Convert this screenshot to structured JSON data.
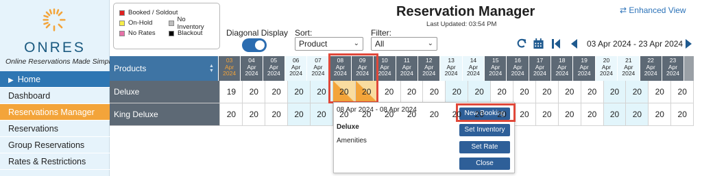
{
  "brand": {
    "name": "ONRES",
    "tagline": "Online Reservations Made Simple"
  },
  "sidebar": {
    "items": [
      {
        "label": "Home"
      },
      {
        "label": "Dashboard"
      },
      {
        "label": "Reservations Manager"
      },
      {
        "label": "Reservations"
      },
      {
        "label": "Group Reservations"
      },
      {
        "label": "Rates & Restrictions"
      }
    ]
  },
  "legend": {
    "booked": "Booked / Soldout",
    "onhold": "On-Hold",
    "noinventory": "No Inventory",
    "norates": "No Rates",
    "blackout": "Blackout",
    "colors": {
      "booked": "#e02020",
      "onhold": "#f7ee4a",
      "noinventory": "#bdbdbd",
      "norates": "#e772a8",
      "blackout": "#000000"
    }
  },
  "header": {
    "title": "Reservation Manager",
    "updated": "Last Updated: 03:54 PM",
    "enhanced": "Enhanced View"
  },
  "controls": {
    "diagonal_label": "Diagonal Display",
    "diagonal_on": true,
    "sort_label": "Sort:",
    "sort_value": "Product",
    "filter_label": "Filter:",
    "filter_value": "All",
    "date_range": "03 Apr 2024 - 23 Apr 2024"
  },
  "icons": [
    "refresh-icon",
    "calendar-icon",
    "first-page-icon",
    "prev-icon",
    "next-icon",
    "swap-icon",
    "sun-logo-icon"
  ],
  "grid": {
    "header_label": "Products",
    "dates": [
      {
        "d": "03",
        "m": "Apr",
        "y": "2024"
      },
      {
        "d": "04",
        "m": "Apr",
        "y": "2024"
      },
      {
        "d": "05",
        "m": "Apr",
        "y": "2024"
      },
      {
        "d": "06",
        "m": "Apr",
        "y": "2024"
      },
      {
        "d": "07",
        "m": "Apr",
        "y": "2024"
      },
      {
        "d": "08",
        "m": "Apr",
        "y": "2024"
      },
      {
        "d": "09",
        "m": "Apr",
        "y": "2024"
      },
      {
        "d": "10",
        "m": "Apr",
        "y": "2024"
      },
      {
        "d": "11",
        "m": "Apr",
        "y": "2024"
      },
      {
        "d": "12",
        "m": "Apr",
        "y": "2024"
      },
      {
        "d": "13",
        "m": "Apr",
        "y": "2024"
      },
      {
        "d": "14",
        "m": "Apr",
        "y": "2024"
      },
      {
        "d": "15",
        "m": "Apr",
        "y": "2024"
      },
      {
        "d": "16",
        "m": "Apr",
        "y": "2024"
      },
      {
        "d": "17",
        "m": "Apr",
        "y": "2024"
      },
      {
        "d": "18",
        "m": "Apr",
        "y": "2024"
      },
      {
        "d": "19",
        "m": "Apr",
        "y": "2024"
      },
      {
        "d": "20",
        "m": "Apr",
        "y": "2024"
      },
      {
        "d": "21",
        "m": "Apr",
        "y": "2024"
      },
      {
        "d": "22",
        "m": "Apr",
        "y": "2024"
      },
      {
        "d": "23",
        "m": "Apr",
        "y": "2024"
      }
    ],
    "rooms": [
      {
        "name": "Deluxe",
        "values": [
          "19",
          "20",
          "20",
          "20",
          "20",
          "20",
          "20",
          "20",
          "20",
          "20",
          "20",
          "20",
          "20",
          "20",
          "20",
          "20",
          "20",
          "20",
          "20",
          "20",
          "20"
        ]
      },
      {
        "name": "King Deluxe",
        "values": [
          "20",
          "20",
          "20",
          "20",
          "20",
          "20",
          "20",
          "20",
          "20",
          "20",
          "20",
          "20",
          "20",
          "20",
          "20",
          "20",
          "20",
          "20",
          "20",
          "20",
          "20"
        ]
      }
    ]
  },
  "popup": {
    "date": "08 Apr 2024 - 08 Apr 2024",
    "room": "Deluxe",
    "amenities": "Amenities",
    "buttons": [
      "New Booking",
      "Set Inventory",
      "Set Rate",
      "Close"
    ]
  }
}
